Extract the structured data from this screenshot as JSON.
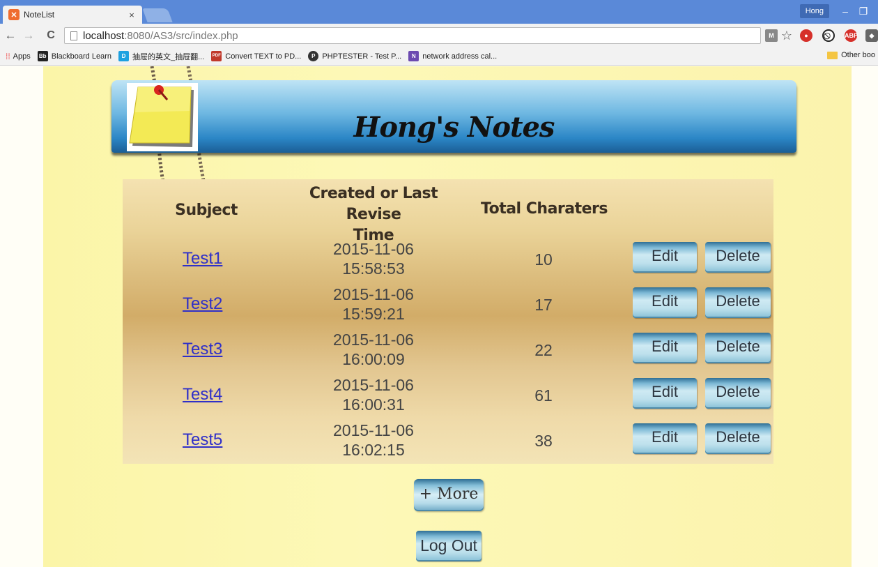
{
  "browser": {
    "tab_title": "NoteList",
    "tab_close": "×",
    "profile_name": "Hong",
    "minimize": "–",
    "restore": "❐",
    "back": "←",
    "forward": "→",
    "reload": "C",
    "url_host": "localhost",
    "url_path": ":8080/AS3/src/index.php",
    "star": "☆"
  },
  "bookmarks": {
    "apps": "Apps",
    "items": [
      {
        "label": "Blackboard Learn",
        "icon": "Bb",
        "color": "#222222"
      },
      {
        "label": "抽屉的英文_抽屉翻...",
        "icon": "D",
        "color": "#1ea1e0"
      },
      {
        "label": "Convert TEXT to PD...",
        "icon": "PDF",
        "color": "#c0392b"
      },
      {
        "label": "PHPTESTER - Test P...",
        "icon": "P",
        "color": "#333333"
      },
      {
        "label": "network address cal...",
        "icon": "N",
        "color": "#6c4ab0"
      }
    ],
    "other": "Other boo"
  },
  "header": {
    "title": "Hong's Notes"
  },
  "table": {
    "headers": {
      "subject": "Subject",
      "time_line1": "Created or Last Revise",
      "time_line2": "Time",
      "chars": "Total Charaters"
    },
    "edit_label": "Edit",
    "delete_label": "Delete",
    "rows": [
      {
        "subject": "Test1",
        "date": "2015-11-06",
        "time": "15:58:53",
        "chars": "10"
      },
      {
        "subject": "Test2",
        "date": "2015-11-06",
        "time": "15:59:21",
        "chars": "17"
      },
      {
        "subject": "Test3",
        "date": "2015-11-06",
        "time": "16:00:09",
        "chars": "22"
      },
      {
        "subject": "Test4",
        "date": "2015-11-06",
        "time": "16:00:31",
        "chars": "61"
      },
      {
        "subject": "Test5",
        "date": "2015-11-06",
        "time": "16:02:15",
        "chars": "38"
      }
    ]
  },
  "actions": {
    "more": "+ More",
    "logout": "Log Out"
  },
  "colors": {
    "banner_blue": "#2b86c6",
    "paper_yellow": "#fdf8b7",
    "link_blue": "#2f2fc8"
  }
}
